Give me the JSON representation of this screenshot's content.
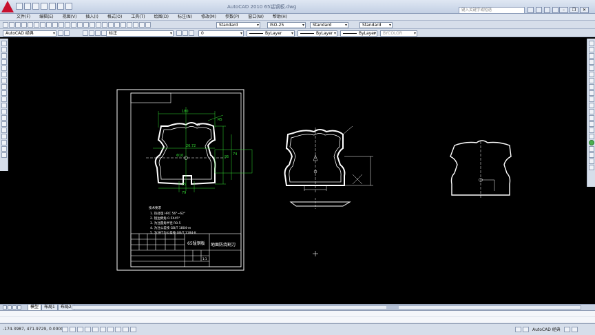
{
  "titlebar": {
    "title": "AutoCAD 2010    65锰钢板.dwg",
    "search_placeholder": "键入关键字或短语"
  },
  "menu": [
    "文件(F)",
    "编辑(E)",
    "视图(V)",
    "插入(I)",
    "格式(O)",
    "工具(T)",
    "绘图(D)",
    "标注(N)",
    "修改(M)",
    "参数(P)",
    "窗口(W)",
    "帮助(H)"
  ],
  "toolbar1": {
    "text_style": "Standard",
    "dim_style": "ISO-25",
    "table_style": "Standard",
    "mleader_style": "Standard"
  },
  "toolbar2": {
    "workspace": "AutoCAD 经典",
    "annotation": "标注",
    "layer": "0",
    "color": "ByLayer",
    "linetype": "ByLayer",
    "lineweight": "ByLayer",
    "plotstyle": "BYCOLOR"
  },
  "drawing": {
    "title_block": {
      "material": "65锰钢板",
      "part_name": "地面防烧割刀",
      "scale": "1:1"
    },
    "tech_req_title": "技术要求",
    "tech_requirements": [
      "1.  热处理 HRC 56°~62°",
      "2.  锐边倒角 0.5X45°",
      "3.  为注圆角半径 R0.5",
      "4.  为注公差按 GB/T 1804-m",
      "5.  为注行为公差按 GB/T 1184-K"
    ],
    "dims": {
      "top": "180",
      "mid": "26.72",
      "height": "95",
      "right": "74",
      "bottom": "79",
      "hole": "Φ10",
      "small": "25",
      "r": "R5"
    }
  },
  "tabs": [
    "模型",
    "布局1",
    "布局2"
  ],
  "active_tab": "模型",
  "command": {
    "line1": "",
    "line2": ""
  },
  "status": {
    "coords": "-174.3987, 471.9729, 0.0000",
    "workspace": "AutoCAD 经典"
  }
}
